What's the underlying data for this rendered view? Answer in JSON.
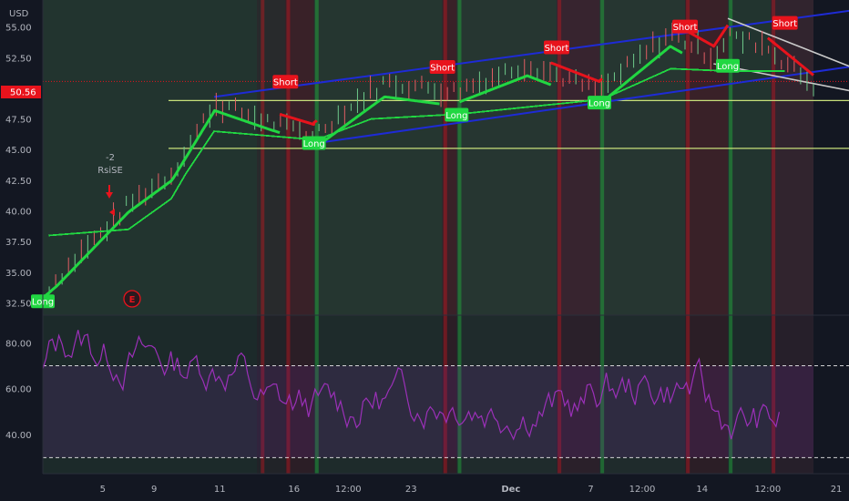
{
  "currency_label": "USD",
  "current_price_label": "50.56",
  "price_axis": [
    "55.00",
    "52.50",
    "47.50",
    "45.00",
    "42.50",
    "40.00",
    "37.50",
    "35.00",
    "32.50"
  ],
  "rsi_axis": [
    "80.00",
    "60.00",
    "40.00"
  ],
  "time_axis": [
    "5",
    "9",
    "11",
    "16",
    "12:00",
    "23",
    "Dec",
    "7",
    "12:00",
    "14",
    "12:00",
    "21"
  ],
  "annotation": {
    "value": "-2",
    "name": "RsiSE"
  },
  "event_marker": "E",
  "colors": {
    "background": "#131722",
    "trend_channel": "#1e2bd6",
    "wedge": "#c9c9c9",
    "support": "#c8e07a",
    "long": "#21d742",
    "short": "#e8131c",
    "rsi": "#9b30b8",
    "rsi_band": "#ffffff"
  },
  "chart_data": {
    "type": "line",
    "panes": [
      {
        "name": "price",
        "y_range": [
          31.5,
          57.2
        ],
        "y_ticks": [
          55.0,
          52.5,
          47.5,
          45.0,
          42.5,
          40.0,
          37.5,
          35.0,
          32.5
        ],
        "current_price": 50.56,
        "horizontal_lines": [
          49.0,
          45.1
        ],
        "signals": [
          {
            "label": "Long",
            "x": 0.0,
            "price": 32.6
          },
          {
            "label": "Short",
            "x": 8.5,
            "price": 50.5
          },
          {
            "label": "Long",
            "x": 9.5,
            "price": 45.5
          },
          {
            "label": "Short",
            "x": 14.0,
            "price": 51.7
          },
          {
            "label": "Long",
            "x": 14.5,
            "price": 47.8
          },
          {
            "label": "Short",
            "x": 18.0,
            "price": 53.3
          },
          {
            "label": "Long",
            "x": 19.5,
            "price": 48.8
          },
          {
            "label": "Short",
            "x": 22.5,
            "price": 55.0
          },
          {
            "label": "Long",
            "x": 24.0,
            "price": 51.8
          },
          {
            "label": "Short",
            "x": 26.0,
            "price": 55.3
          }
        ]
      },
      {
        "name": "rsi",
        "y_range": [
          23,
          92
        ],
        "y_ticks": [
          80,
          60,
          40
        ],
        "bands": [
          70,
          30
        ]
      }
    ]
  },
  "toolbar": {}
}
